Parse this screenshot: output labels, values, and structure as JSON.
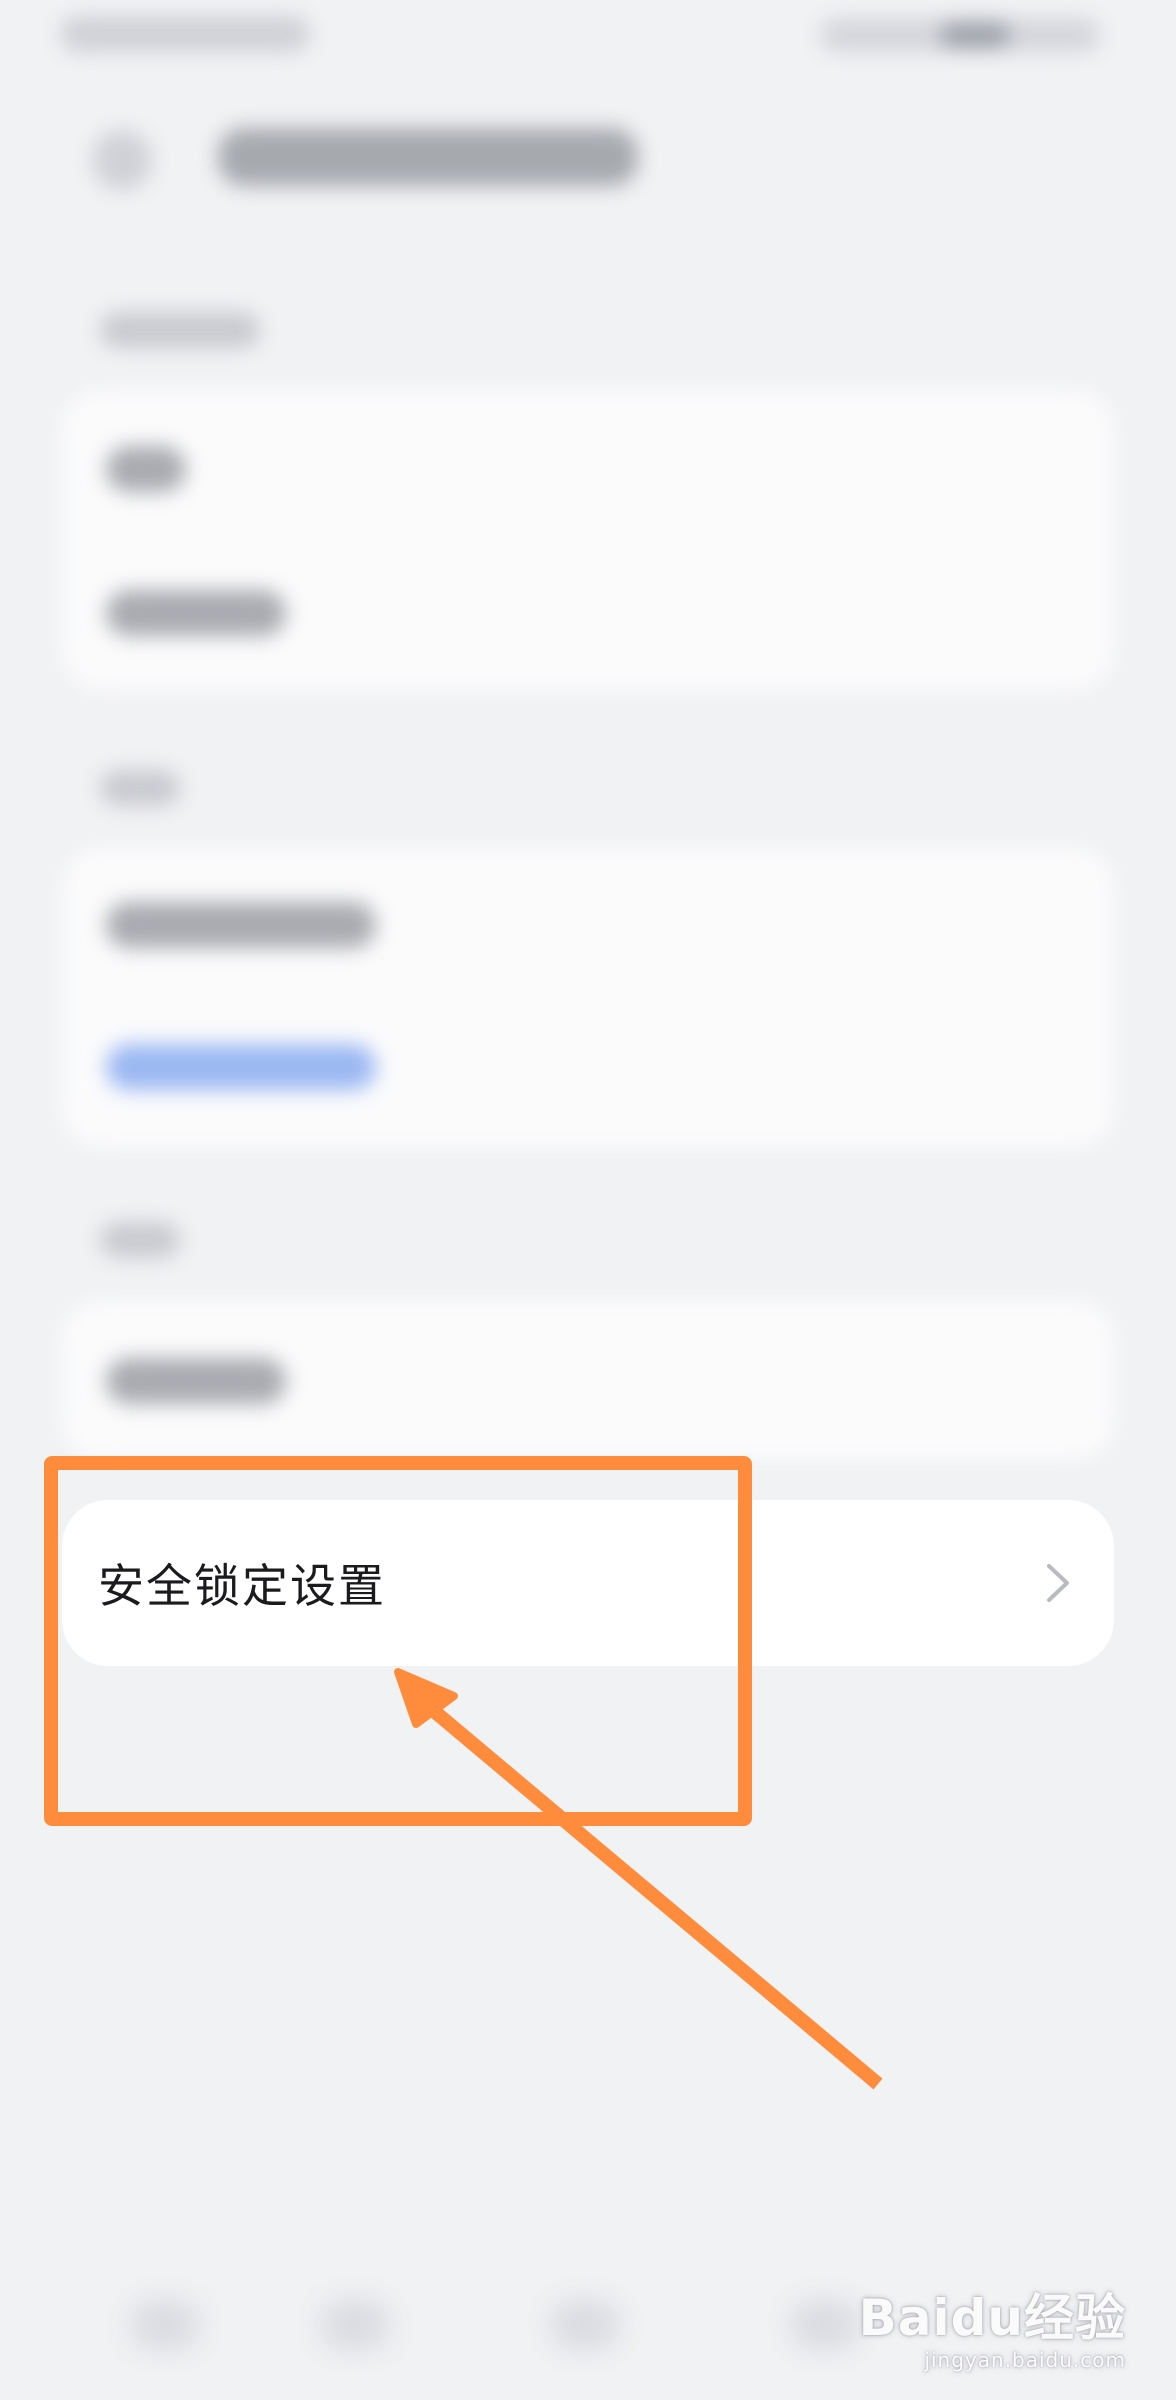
{
  "settings_item": {
    "label": "安全锁定设置",
    "chevron_icon": "chevron-right-icon"
  },
  "annotation": {
    "color": "#ff8c3c"
  },
  "watermark": {
    "brand": "Baidu经验",
    "url": "jingyan.baidu.com"
  }
}
